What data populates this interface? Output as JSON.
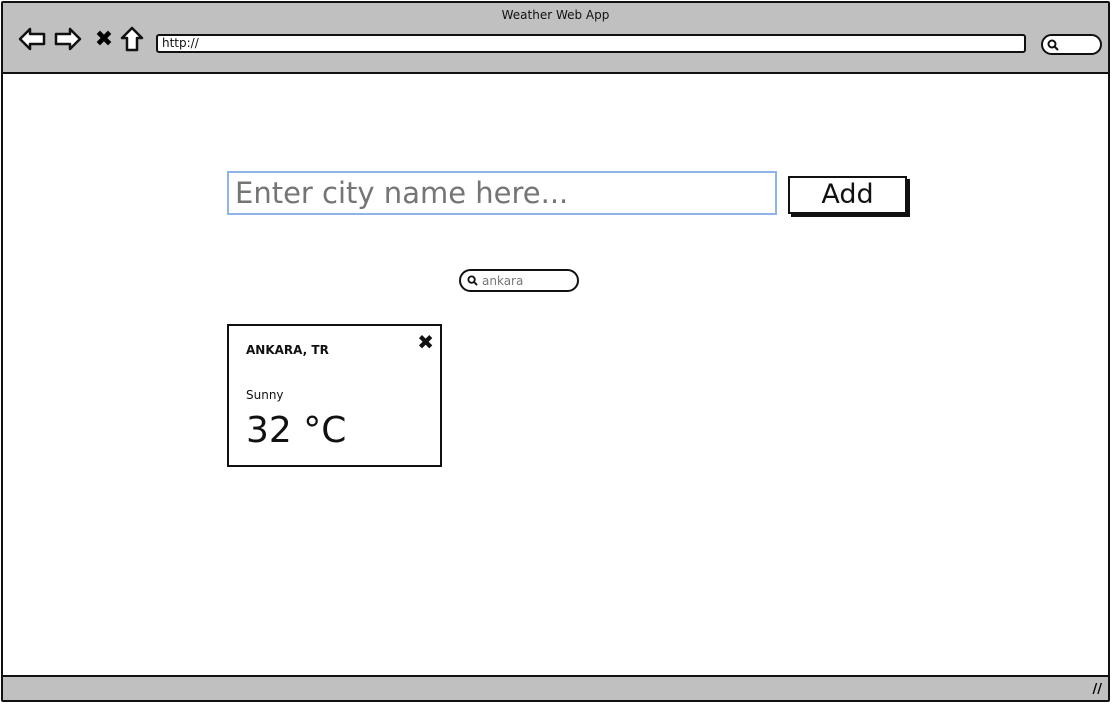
{
  "browser": {
    "title": "Weather Web App",
    "url": "http://"
  },
  "form": {
    "placeholder": "Enter city name here...",
    "add_label": "Add"
  },
  "filter": {
    "value": "ankara"
  },
  "cards": [
    {
      "city": "ANKARA, TR",
      "condition": "Sunny",
      "temperature": "32 °C",
      "close_icon": "✖"
    }
  ]
}
